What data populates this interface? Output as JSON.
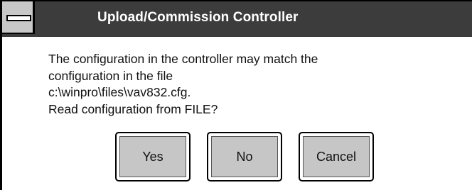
{
  "dialog": {
    "title": "Upload/Commission Controller",
    "message_lines": [
      "The configuration in the controller may match the",
      "configuration in the file",
      "c:\\winpro\\files\\vav832.cfg.",
      "Read configuration from FILE?"
    ],
    "buttons": {
      "yes": "Yes",
      "no": "No",
      "cancel": "Cancel"
    }
  },
  "colors": {
    "titlebar": "#3c3c3c",
    "title_text": "#ffffff",
    "button_face": "#c6c6c6",
    "background": "#ffffff"
  }
}
